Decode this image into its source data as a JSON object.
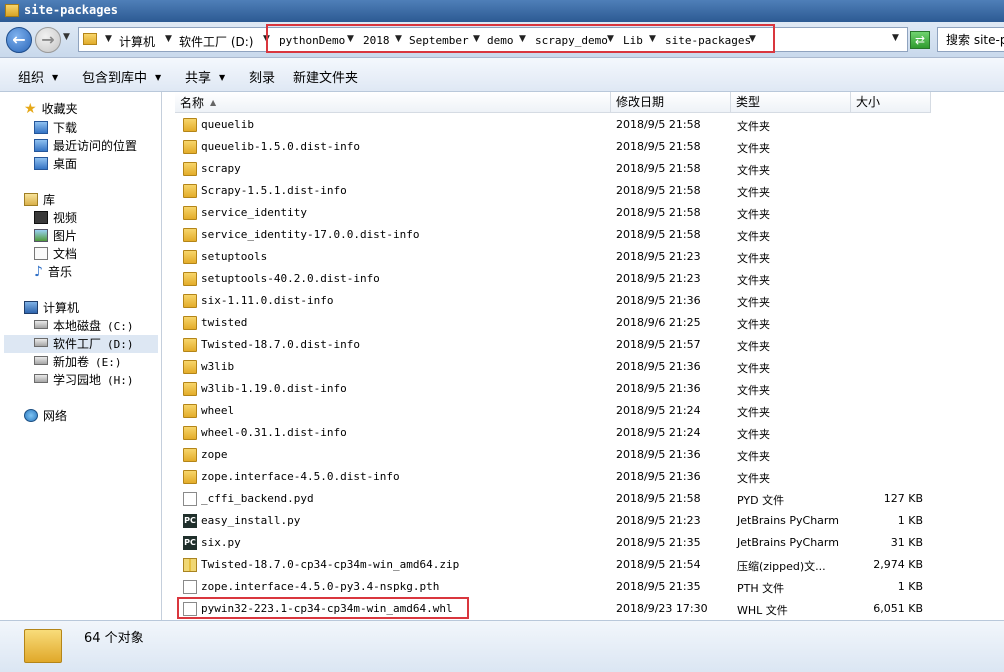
{
  "window": {
    "title": "site-packages"
  },
  "address": {
    "segments": [
      "计算机",
      "软件工厂 (D:)",
      "pythonDemo",
      "2018",
      "September",
      "demo",
      "scrapy_demo",
      "Lib",
      "site-packages"
    ],
    "search_placeholder": "搜索 site-packages"
  },
  "toolbar": {
    "items": [
      {
        "label": "组织",
        "has_dropdown": true
      },
      {
        "label": "包含到库中",
        "has_dropdown": true
      },
      {
        "label": "共享",
        "has_dropdown": true
      },
      {
        "label": "刻录",
        "has_dropdown": false
      },
      {
        "label": "新建文件夹",
        "has_dropdown": false
      }
    ]
  },
  "nav": {
    "favorites": {
      "label": "收藏夹",
      "items": [
        "下载",
        "最近访问的位置",
        "桌面"
      ]
    },
    "libraries": {
      "label": "库",
      "items": [
        "视频",
        "图片",
        "文档",
        "音乐"
      ]
    },
    "computer": {
      "label": "计算机",
      "drives": [
        {
          "name": "本地磁盘",
          "letter": "(C:)"
        },
        {
          "name": "软件工厂",
          "letter": "(D:)",
          "selected": true
        },
        {
          "name": "新加卷",
          "letter": "(E:)"
        },
        {
          "name": "学习园地",
          "letter": "(H:)"
        }
      ]
    },
    "network": {
      "label": "网络"
    }
  },
  "columns": {
    "name": "名称",
    "date": "修改日期",
    "type": "类型",
    "size": "大小"
  },
  "files": [
    {
      "name": "queuelib",
      "date": "2018/9/5 21:58",
      "type": "文件夹",
      "size": "",
      "icon": "folder"
    },
    {
      "name": "queuelib-1.5.0.dist-info",
      "date": "2018/9/5 21:58",
      "type": "文件夹",
      "size": "",
      "icon": "folder"
    },
    {
      "name": "scrapy",
      "date": "2018/9/5 21:58",
      "type": "文件夹",
      "size": "",
      "icon": "folder"
    },
    {
      "name": "Scrapy-1.5.1.dist-info",
      "date": "2018/9/5 21:58",
      "type": "文件夹",
      "size": "",
      "icon": "folder"
    },
    {
      "name": "service_identity",
      "date": "2018/9/5 21:58",
      "type": "文件夹",
      "size": "",
      "icon": "folder"
    },
    {
      "name": "service_identity-17.0.0.dist-info",
      "date": "2018/9/5 21:58",
      "type": "文件夹",
      "size": "",
      "icon": "folder"
    },
    {
      "name": "setuptools",
      "date": "2018/9/5 21:23",
      "type": "文件夹",
      "size": "",
      "icon": "folder"
    },
    {
      "name": "setuptools-40.2.0.dist-info",
      "date": "2018/9/5 21:23",
      "type": "文件夹",
      "size": "",
      "icon": "folder"
    },
    {
      "name": "six-1.11.0.dist-info",
      "date": "2018/9/5 21:36",
      "type": "文件夹",
      "size": "",
      "icon": "folder"
    },
    {
      "name": "twisted",
      "date": "2018/9/6 21:25",
      "type": "文件夹",
      "size": "",
      "icon": "folder"
    },
    {
      "name": "Twisted-18.7.0.dist-info",
      "date": "2018/9/5 21:57",
      "type": "文件夹",
      "size": "",
      "icon": "folder"
    },
    {
      "name": "w3lib",
      "date": "2018/9/5 21:36",
      "type": "文件夹",
      "size": "",
      "icon": "folder"
    },
    {
      "name": "w3lib-1.19.0.dist-info",
      "date": "2018/9/5 21:36",
      "type": "文件夹",
      "size": "",
      "icon": "folder"
    },
    {
      "name": "wheel",
      "date": "2018/9/5 21:24",
      "type": "文件夹",
      "size": "",
      "icon": "folder"
    },
    {
      "name": "wheel-0.31.1.dist-info",
      "date": "2018/9/5 21:24",
      "type": "文件夹",
      "size": "",
      "icon": "folder"
    },
    {
      "name": "zope",
      "date": "2018/9/5 21:36",
      "type": "文件夹",
      "size": "",
      "icon": "folder"
    },
    {
      "name": "zope.interface-4.5.0.dist-info",
      "date": "2018/9/5 21:36",
      "type": "文件夹",
      "size": "",
      "icon": "folder"
    },
    {
      "name": "_cffi_backend.pyd",
      "date": "2018/9/5 21:58",
      "type": "PYD 文件",
      "size": "127 KB",
      "icon": "file"
    },
    {
      "name": "easy_install.py",
      "date": "2018/9/5 21:23",
      "type": "JetBrains PyCharm",
      "size": "1 KB",
      "icon": "pycharm"
    },
    {
      "name": "six.py",
      "date": "2018/9/5 21:35",
      "type": "JetBrains PyCharm",
      "size": "31 KB",
      "icon": "pycharm"
    },
    {
      "name": "Twisted-18.7.0-cp34-cp34m-win_amd64.zip",
      "date": "2018/9/5 21:54",
      "type": "压缩(zipped)文...",
      "size": "2,974 KB",
      "icon": "zip"
    },
    {
      "name": "zope.interface-4.5.0-py3.4-nspkg.pth",
      "date": "2018/9/5 21:35",
      "type": "PTH 文件",
      "size": "1 KB",
      "icon": "file"
    },
    {
      "name": "pywin32-223.1-cp34-cp34m-win_amd64.whl",
      "date": "2018/9/23 17:30",
      "type": "WHL 文件",
      "size": "6,051 KB",
      "icon": "file",
      "highlighted": true
    }
  ],
  "status": {
    "object_count": "64 个对象"
  },
  "colors": {
    "highlight_red": "#d9363e",
    "title_blue": "#2c5a93",
    "folder_yellow": "#e3ac2a"
  }
}
